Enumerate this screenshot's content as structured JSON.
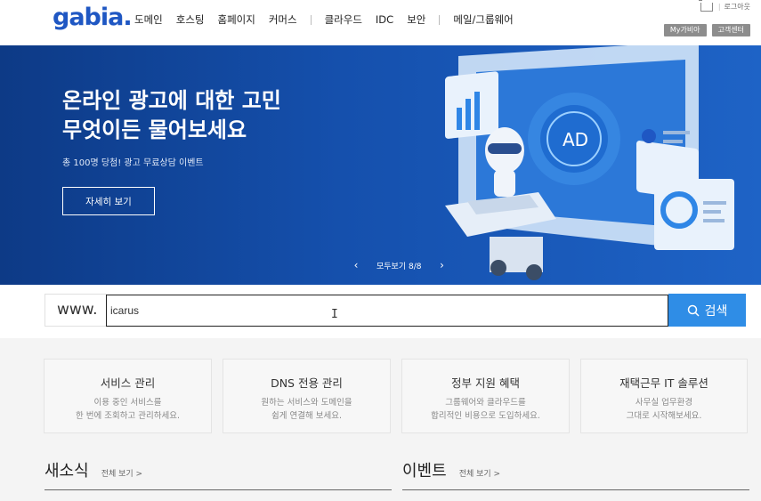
{
  "header": {
    "logo": "gabia.",
    "nav": [
      "도메인",
      "호스팅",
      "홈페이지",
      "커머스",
      "클라우드",
      "IDC",
      "보안",
      "메일/그룹웨어"
    ],
    "logout": "로그아웃",
    "my_label": "My가비아",
    "support_label": "고객센터"
  },
  "hero": {
    "title": "온라인 광고에 대한 고민\n무엇이든 물어보세요",
    "subtitle": "총 100명 당첨! 광고 무료상담 이벤트",
    "button": "자세히 보기",
    "pager_label": "모두보기 8/8",
    "illustration_text": "AD"
  },
  "search": {
    "prefix": "www.",
    "value": "icarus",
    "button": "검색"
  },
  "cards": [
    {
      "title": "서비스 관리",
      "desc": "이용 중인 서비스를\n한 번에 조회하고 관리하세요."
    },
    {
      "title": "DNS 전용 관리",
      "desc": "원하는 서비스와 도메인을\n쉽게 연결해 보세요."
    },
    {
      "title": "정부 지원 혜택",
      "desc": "그룹웨어와 클라우드를\n합리적인 비용으로 도입하세요."
    },
    {
      "title": "재택근무 IT 솔루션",
      "desc": "사무실 업무환경\n그대로 시작해보세요."
    }
  ],
  "news": {
    "title": "새소식",
    "more": "전체 보기 >"
  },
  "events": {
    "title": "이벤트",
    "more": "전체 보기 >"
  },
  "colors": {
    "brand": "#1f57c3",
    "hero_bg": "#1550ad",
    "search_button": "#2f8de6"
  }
}
